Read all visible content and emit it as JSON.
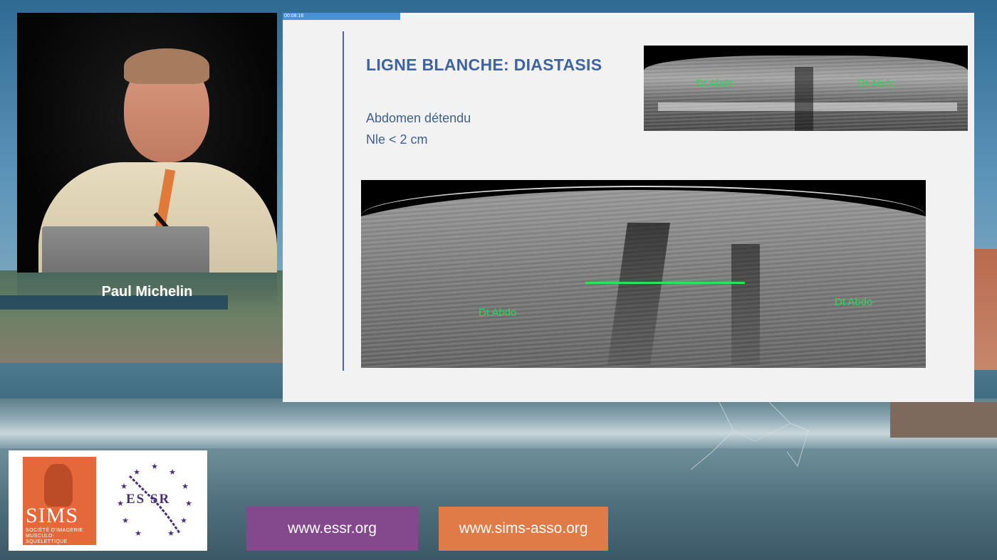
{
  "speaker": {
    "name": "Paul Michelin"
  },
  "slide": {
    "timer": "00:08:16",
    "progress": 0.17,
    "title": "LIGNE BLANCHE: DIASTASIS",
    "body_lines": [
      "Abdomen détendu",
      "Nle < 2 cm"
    ],
    "ultrasound_top": {
      "label_left": "Dt Abdo",
      "label_right": "Dt Abdo"
    },
    "ultrasound_bottom": {
      "label_left": "Dt Abdo",
      "label_right": "Dt Abdo"
    },
    "colors": {
      "title": "#3f63a0",
      "measure_line": "#2ee05a",
      "label": "#32d25a"
    }
  },
  "branding": {
    "sims_logo_text": "SIMS",
    "sims_logo_subtitle": "SOCIÉTÉ D'IMAGERIE MUSCULO-SQUELETTIQUE",
    "essr_logo_text": "ES SR",
    "essr_url": "www.essr.org",
    "sims_url": "www.sims-asso.org",
    "colors": {
      "essr": "#84498d",
      "sims": "#e07a47"
    }
  }
}
